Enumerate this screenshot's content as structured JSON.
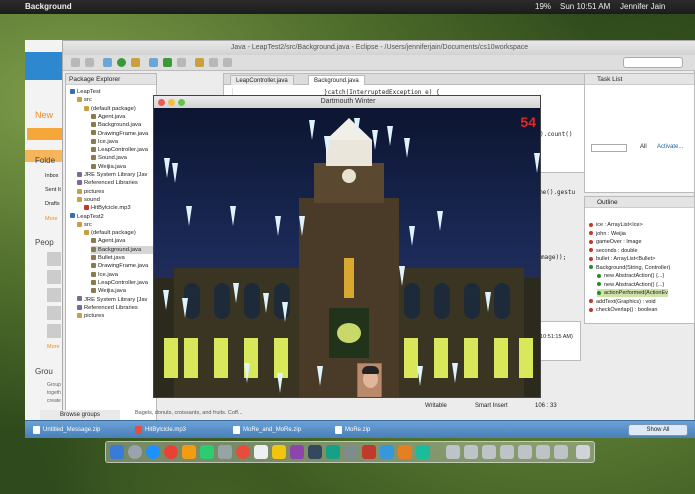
{
  "menubar": {
    "app_name": "Background",
    "right_items": [
      "19%",
      "Sun 10:51 AM",
      "Jennifer Jain"
    ]
  },
  "eclipse": {
    "title": "Java - LeapTest2/src/Background.java - Eclipse - /Users/jenniferjain/Documents/cs10workspace",
    "package_explorer_label": "Package Explorer",
    "tree": [
      {
        "label": "LeapTest",
        "depth": 0,
        "color": "#3a6fb0"
      },
      {
        "label": "src",
        "depth": 1,
        "color": "#c9a040"
      },
      {
        "label": "(default package)",
        "depth": 2,
        "color": "#c9a040"
      },
      {
        "label": "Agent.java",
        "depth": 3,
        "color": "#8b7a4f"
      },
      {
        "label": "Background.java",
        "depth": 3,
        "color": "#8b7a4f"
      },
      {
        "label": "DrawingFrame.java",
        "depth": 3,
        "color": "#8b7a4f"
      },
      {
        "label": "Ice.java",
        "depth": 3,
        "color": "#8b7a4f"
      },
      {
        "label": "LeapController.java",
        "depth": 3,
        "color": "#8b7a4f"
      },
      {
        "label": "Sound.java",
        "depth": 3,
        "color": "#8b7a4f"
      },
      {
        "label": "Weijia.java",
        "depth": 3,
        "color": "#8b7a4f"
      },
      {
        "label": "JRE System Library [Jav",
        "depth": 1,
        "color": "#7a6a9a"
      },
      {
        "label": "Referenced Libraries",
        "depth": 1,
        "color": "#7a6a9a"
      },
      {
        "label": "pictures",
        "depth": 1,
        "color": "#c9a040"
      },
      {
        "label": "sound",
        "depth": 1,
        "color": "#c9a040"
      },
      {
        "label": "HitBylcicle.mp3",
        "depth": 2,
        "color": "#c0392b"
      },
      {
        "label": "LeapTest2",
        "depth": 0,
        "color": "#3a6fb0"
      },
      {
        "label": "src",
        "depth": 1,
        "color": "#c9a040"
      },
      {
        "label": "(default package)",
        "depth": 2,
        "color": "#c9a040"
      },
      {
        "label": "Agent.java",
        "depth": 3,
        "color": "#8b7a4f"
      },
      {
        "label": "Background.java",
        "depth": 3,
        "color": "#8b7a4f"
      },
      {
        "label": "Bullet.java",
        "depth": 3,
        "color": "#8b7a4f"
      },
      {
        "label": "DrawingFrame.java",
        "depth": 3,
        "color": "#8b7a4f"
      },
      {
        "label": "Ice.java",
        "depth": 3,
        "color": "#8b7a4f"
      },
      {
        "label": "LeapController.java",
        "depth": 3,
        "color": "#8b7a4f"
      },
      {
        "label": "Weijia.java",
        "depth": 3,
        "color": "#8b7a4f"
      },
      {
        "label": "JRE System Library [Jav",
        "depth": 1,
        "color": "#7a6a9a"
      },
      {
        "label": "Referenced Libraries",
        "depth": 1,
        "color": "#7a6a9a"
      },
      {
        "label": "pictures",
        "depth": 1,
        "color": "#c9a040"
      }
    ],
    "tabs": [
      "LeapController.java",
      "Background.java"
    ],
    "code_lines": [
      "}catch(InterruptedException e) {",
      ").count()",
      "me().gestu",
      "mage));"
    ],
    "task_list_label": "Task List",
    "task_filter_all": "All",
    "task_activate": "Activate...",
    "outline_label": "Outline",
    "outline_items": [
      {
        "label": "ice : ArrayList<Ice>",
        "color": "#c0392b"
      },
      {
        "label": "john : Weijia",
        "color": "#c0392b"
      },
      {
        "label": "gameOver : Image",
        "color": "#c0392b"
      },
      {
        "label": "seconds : double",
        "color": "#c0392b"
      },
      {
        "label": "bullet : ArrayList<Bullet>",
        "color": "#c0392b"
      },
      {
        "label": "Background(String, Controller)",
        "color": "#2a8a2a"
      },
      {
        "label": "new AbstractAction() {...}",
        "color": "#2a8a2a"
      },
      {
        "label": "new AbstractAction() {...}",
        "color": "#2a8a2a"
      },
      {
        "label": "actionPerformed(ActionEv",
        "color": "#2a8a2a"
      },
      {
        "label": "addText(Graphics) : void",
        "color": "#c0392b"
      },
      {
        "label": "checkOverlap() : boolean",
        "color": "#c0392b"
      }
    ],
    "console_time": "5, 10:51:15 AM)",
    "status": {
      "writable": "Writable",
      "insert": "Smart Insert",
      "position": "106 : 33"
    }
  },
  "mail": {
    "new_label": "New",
    "folders_label": "Folde",
    "folder_items": [
      "Inbox",
      "Sent It",
      "Drafts",
      "More"
    ],
    "people_label": "Peop",
    "more_label": "More",
    "groups_label": "Grou",
    "group_text": [
      "Group",
      "togeth",
      "create"
    ],
    "browse_groups": "Browse groups",
    "footer_snippet": "Bagels, donuts, croissants, and fruits. Coff..."
  },
  "game": {
    "title": "Dartmouth Winter",
    "score": "54"
  },
  "downloads": {
    "items": [
      "Untitled_Message.zip",
      "HitBylcicle.mp3",
      "MoRe_and_MoRe.zip",
      "MoRe.zip"
    ],
    "show_all": "Show All"
  }
}
